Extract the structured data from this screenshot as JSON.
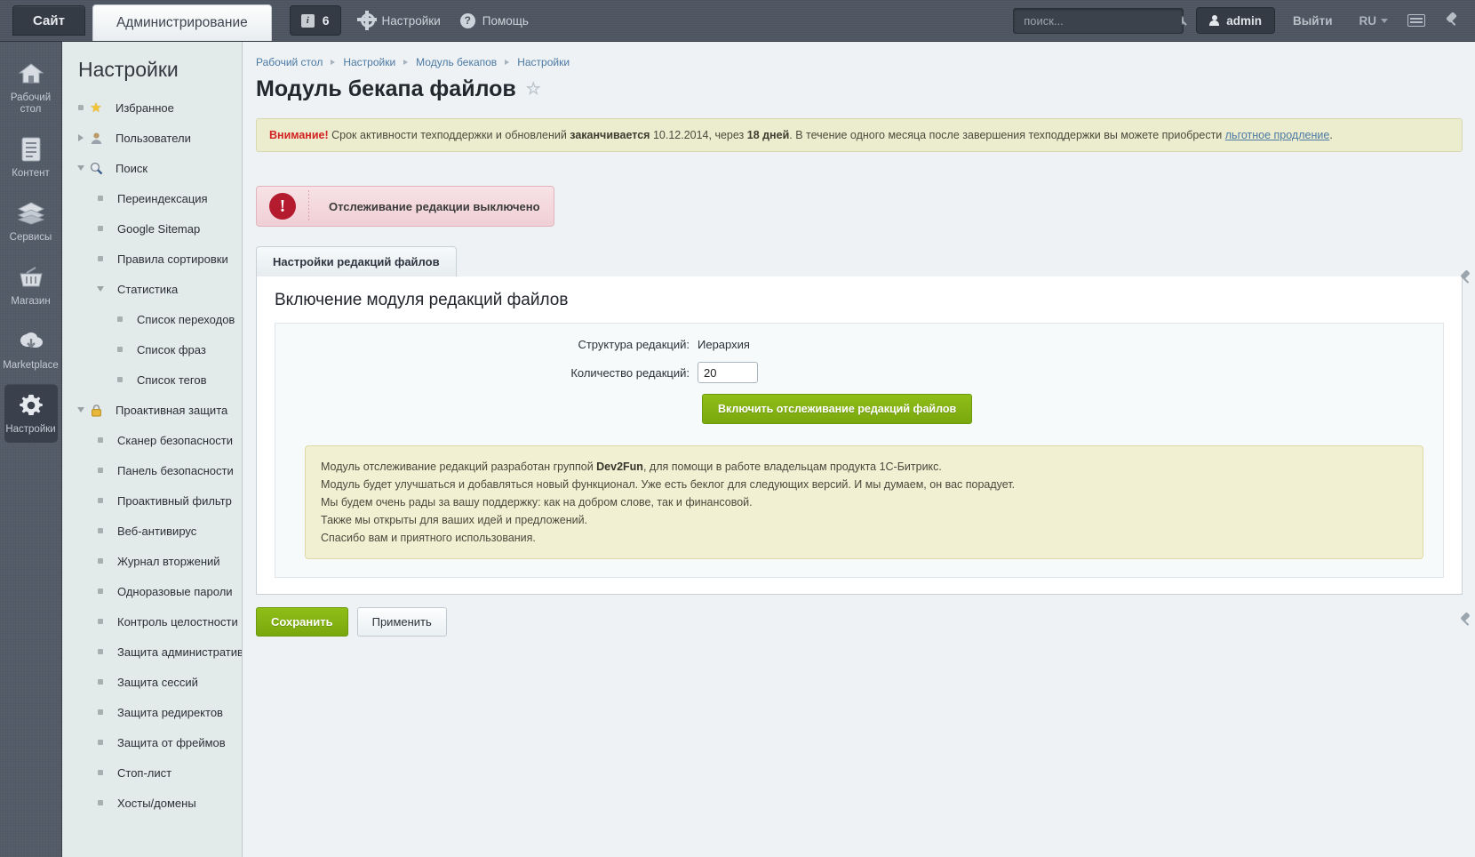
{
  "topbar": {
    "site_tab": "Сайт",
    "admin_tab": "Администрирование",
    "notif_icon": "info-icon",
    "notif_count": "6",
    "settings_label": "Настройки",
    "help_label": "Помощь",
    "search_placeholder": "поиск...",
    "search_value": "",
    "user_label": "admin",
    "logout_label": "Выйти",
    "lang_label": "RU",
    "keyboard_icon": "keyboard-icon",
    "pin_icon": "pin-icon"
  },
  "rail": {
    "items": [
      {
        "label": "Рабочий стол",
        "icon": "home-icon",
        "active": false
      },
      {
        "label": "Контент",
        "icon": "document-icon",
        "active": false
      },
      {
        "label": "Сервисы",
        "icon": "layers-icon",
        "active": false
      },
      {
        "label": "Магазин",
        "icon": "basket-icon",
        "active": false
      },
      {
        "label": "Marketplace",
        "icon": "cloud-download-icon",
        "active": false
      },
      {
        "label": "Настройки",
        "icon": "gear-icon",
        "active": true
      }
    ]
  },
  "menu": {
    "title": "Настройки",
    "items": [
      {
        "label": "Избранное",
        "level": 1,
        "marker": "dot",
        "icon": "star-icon"
      },
      {
        "label": "Пользователи",
        "level": 1,
        "marker": "collapsed",
        "icon": "user-icon"
      },
      {
        "label": "Поиск",
        "level": 1,
        "marker": "expanded",
        "icon": "search-icon"
      },
      {
        "label": "Переиндексация",
        "level": 2,
        "marker": "dot",
        "icon": ""
      },
      {
        "label": "Google Sitemap",
        "level": 2,
        "marker": "dot",
        "icon": ""
      },
      {
        "label": "Правила сортировки",
        "level": 2,
        "marker": "dot",
        "icon": ""
      },
      {
        "label": "Статистика",
        "level": 2,
        "marker": "expanded",
        "icon": ""
      },
      {
        "label": "Список переходов",
        "level": 3,
        "marker": "dot",
        "icon": ""
      },
      {
        "label": "Список фраз",
        "level": 3,
        "marker": "dot",
        "icon": ""
      },
      {
        "label": "Список тегов",
        "level": 3,
        "marker": "dot",
        "icon": ""
      },
      {
        "label": "Проактивная защита",
        "level": 1,
        "marker": "expanded",
        "icon": "lock-icon"
      },
      {
        "label": "Сканер безопасности",
        "level": 2,
        "marker": "dot",
        "icon": ""
      },
      {
        "label": "Панель безопасности",
        "level": 2,
        "marker": "dot",
        "icon": ""
      },
      {
        "label": "Проактивный фильтр",
        "level": 2,
        "marker": "dot",
        "icon": ""
      },
      {
        "label": "Веб-антивирус",
        "level": 2,
        "marker": "dot",
        "icon": ""
      },
      {
        "label": "Журнал вторжений",
        "level": 2,
        "marker": "dot",
        "icon": ""
      },
      {
        "label": "Одноразовые пароли",
        "level": 2,
        "marker": "dot",
        "icon": ""
      },
      {
        "label": "Контроль целостности",
        "level": 2,
        "marker": "dot",
        "icon": ""
      },
      {
        "label": "Защита административной части",
        "level": 2,
        "marker": "dot",
        "icon": ""
      },
      {
        "label": "Защита сессий",
        "level": 2,
        "marker": "dot",
        "icon": ""
      },
      {
        "label": "Защита редиректов",
        "level": 2,
        "marker": "dot",
        "icon": ""
      },
      {
        "label": "Защита от фреймов",
        "level": 2,
        "marker": "dot",
        "icon": ""
      },
      {
        "label": "Стоп-лист",
        "level": 2,
        "marker": "dot",
        "icon": ""
      },
      {
        "label": "Хосты/домены",
        "level": 2,
        "marker": "dot",
        "icon": ""
      }
    ]
  },
  "breadcrumb": [
    "Рабочий стол",
    "Настройки",
    "Модуль бекапов",
    "Настройки"
  ],
  "page": {
    "title": "Модуль бекапа файлов",
    "favorite_icon": "star-outline-icon"
  },
  "notice": {
    "warning_word": "Внимание!",
    "text_1": " Срок активности техподдержки и обновлений ",
    "bold_1": "заканчивается",
    "text_2": " 10.12.2014, через ",
    "bold_2": "18 дней",
    "text_3": ". В течение одного месяца после завершения техподдержки вы можете приобрести ",
    "link": "льготное продление",
    "text_4": "."
  },
  "alert": {
    "icon": "exclamation-icon",
    "text": "Отслеживание редакции выключено"
  },
  "tabs": [
    {
      "label": "Настройки редакций файлов",
      "active": true
    }
  ],
  "form": {
    "heading": "Включение модуля редакций файлов",
    "structure_label": "Структура редакций:",
    "structure_value": "Иерархия",
    "count_label": "Количество редакций:",
    "count_value": "20",
    "enable_button": "Включить отслеживание редакций файлов"
  },
  "infobox": {
    "line1_a": "Модуль отслеживание редакций разработан группой ",
    "line1_b": "Dev2Fun",
    "line1_c": ", для помощи в работе владельцам продукта 1С-Битрикс.",
    "line2": "Модуль будет улучшаться и добавляться новый функционал. Уже есть беклог для следующих версий. И мы думаем, он вас порадует.",
    "line3": "Мы будем очень рады за вашу поддержку: как на добром слове, так и финансовой.",
    "line4": "Также мы открыты для ваших идей и предложений.",
    "line5": "Спасибо вам и приятного использования."
  },
  "footer": {
    "save_label": "Сохранить",
    "apply_label": "Применить",
    "pin_icon": "pin-icon"
  },
  "colors": {
    "accent_green": "#79a80e",
    "alert_red": "#b51b2e",
    "topbar_bg": "#4e5662",
    "menu_bg": "#e3eaea",
    "link_blue": "#4c79a3"
  }
}
